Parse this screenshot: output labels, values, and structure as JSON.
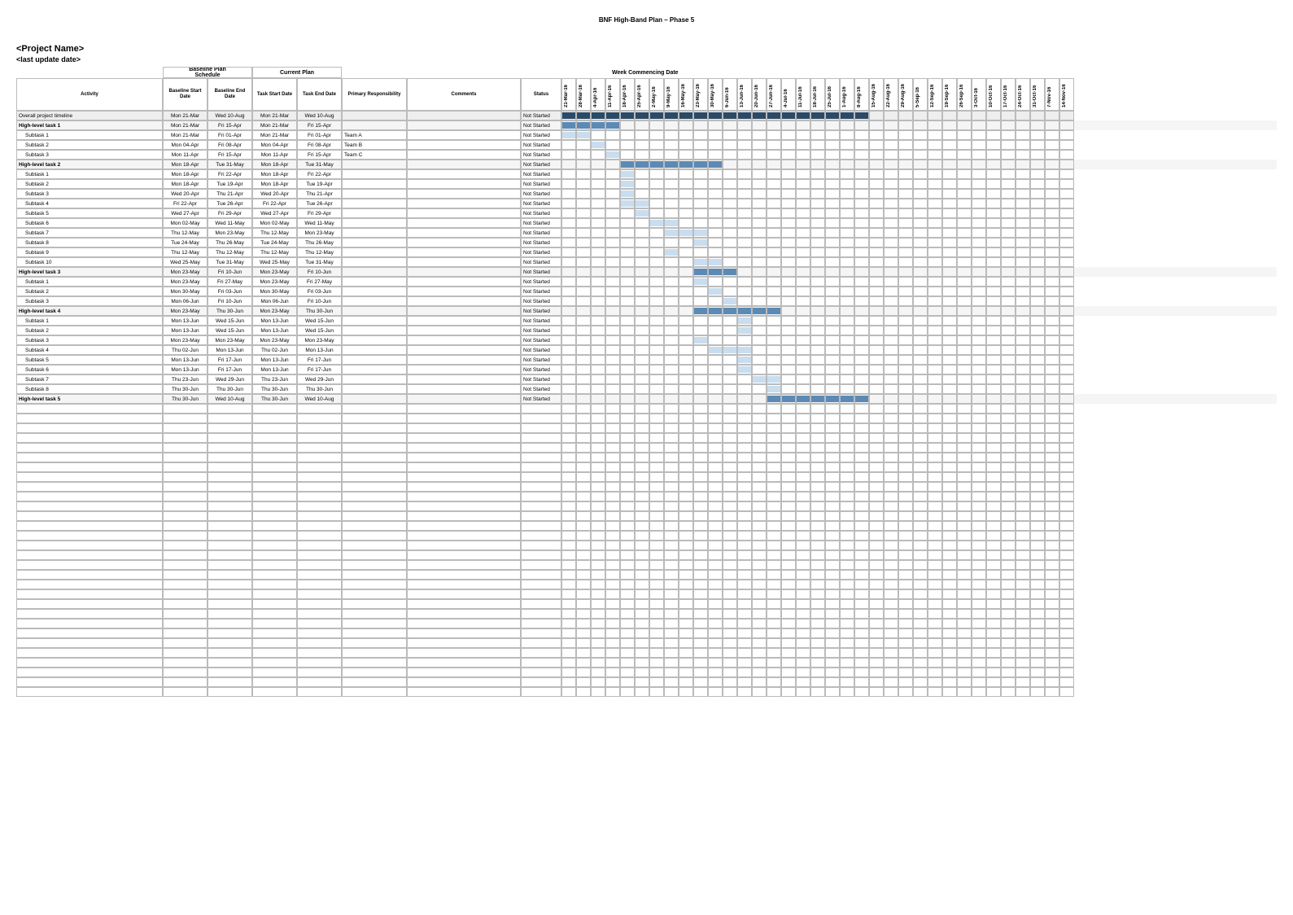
{
  "doc_title": "BNF High-Band Plan – Phase 5",
  "project_name": "<Project Name>",
  "last_update": "<last update date>",
  "headers": {
    "baseline_group": "Baseline Plan\nSchedule",
    "current_group": "Current Plan",
    "wc_group": "Week Commencing Date",
    "activity": "Activity",
    "baseline_start": "Baseline Start Date",
    "baseline_end": "Baseline End Date",
    "task_start": "Task Start Date",
    "task_end": "Task End Date",
    "primary_resp": "Primary Responsibility",
    "comments": "Comments",
    "status": "Status"
  },
  "weeks": [
    "21-Mar-16",
    "28-Mar-16",
    "4-Apr-16",
    "11-Apr-16",
    "18-Apr-16",
    "25-Apr-16",
    "2-May-16",
    "9-May-16",
    "16-May-16",
    "23-May-16",
    "30-May-16",
    "6-Jun-16",
    "13-Jun-16",
    "20-Jun-16",
    "27-Jun-16",
    "4-Jul-16",
    "11-Jul-16",
    "18-Jul-16",
    "25-Jul-16",
    "1-Aug-16",
    "8-Aug-16",
    "15-Aug-16",
    "22-Aug-16",
    "29-Aug-16",
    "5-Sep-16",
    "12-Sep-16",
    "19-Sep-16",
    "26-Sep-16",
    "3-Oct-16",
    "10-Oct-16",
    "17-Oct-16",
    "24-Oct-16",
    "31-Oct-16",
    "7-Nov-16",
    "14-Nov-16"
  ],
  "rows": [
    {
      "activity": "Overall project timeline",
      "bl_start": "Mon 21-Mar",
      "bl_end": "Wed 10-Aug",
      "cur_start": "Mon 21-Mar",
      "cur_end": "Wed 10-Aug",
      "resp": "",
      "comm": "",
      "status": "Not Started",
      "kind": "overall",
      "bar_start": 0,
      "bar_end": 20,
      "bar_class": "bar-dark"
    },
    {
      "activity": "High-level task 1",
      "bl_start": "Mon 21-Mar",
      "bl_end": "Fri 15-Apr",
      "cur_start": "Mon 21-Mar",
      "cur_end": "Fri 15-Apr",
      "resp": "",
      "comm": "",
      "status": "Not Started",
      "kind": "section",
      "bar_start": 0,
      "bar_end": 3,
      "bar_class": "bar-med"
    },
    {
      "activity": "Subtask 1",
      "bl_start": "Mon 21-Mar",
      "bl_end": "Fri 01-Apr",
      "cur_start": "Mon 21-Mar",
      "cur_end": "Fri 01-Apr",
      "resp": "Team A",
      "comm": "",
      "status": "Not Started",
      "kind": "sub",
      "bar_start": 0,
      "bar_end": 1,
      "bar_class": "bar-light"
    },
    {
      "activity": "Subtask 2",
      "bl_start": "Mon 04-Apr",
      "bl_end": "Fri 08-Apr",
      "cur_start": "Mon 04-Apr",
      "cur_end": "Fri 08-Apr",
      "resp": "Team B",
      "comm": "",
      "status": "Not Started",
      "kind": "sub",
      "bar_start": 2,
      "bar_end": 2,
      "bar_class": "bar-light"
    },
    {
      "activity": "Subtask 3",
      "bl_start": "Mon 11-Apr",
      "bl_end": "Fri 15-Apr",
      "cur_start": "Mon 11-Apr",
      "cur_end": "Fri 15-Apr",
      "resp": "Team C",
      "comm": "",
      "status": "Not Started",
      "kind": "sub",
      "bar_start": 3,
      "bar_end": 3,
      "bar_class": "bar-light"
    },
    {
      "activity": "High-level task 2",
      "bl_start": "Mon 18-Apr",
      "bl_end": "Tue 31-May",
      "cur_start": "Mon 18-Apr",
      "cur_end": "Tue 31-May",
      "resp": "",
      "comm": "",
      "status": "Not Started",
      "kind": "section",
      "bar_start": 4,
      "bar_end": 10,
      "bar_class": "bar-med"
    },
    {
      "activity": "Subtask 1",
      "bl_start": "Mon 18-Apr",
      "bl_end": "Fri 22-Apr",
      "cur_start": "Mon 18-Apr",
      "cur_end": "Fri 22-Apr",
      "resp": "",
      "comm": "",
      "status": "Not Started",
      "kind": "sub",
      "bar_start": 4,
      "bar_end": 4,
      "bar_class": "bar-light"
    },
    {
      "activity": "Subtask 2",
      "bl_start": "Mon 18-Apr",
      "bl_end": "Tue 19-Apr",
      "cur_start": "Mon 18-Apr",
      "cur_end": "Tue 19-Apr",
      "resp": "",
      "comm": "",
      "status": "Not Started",
      "kind": "sub",
      "bar_start": 4,
      "bar_end": 4,
      "bar_class": "bar-light"
    },
    {
      "activity": "Subtask 3",
      "bl_start": "Wed 20-Apr",
      "bl_end": "Thu 21-Apr",
      "cur_start": "Wed 20-Apr",
      "cur_end": "Thu 21-Apr",
      "resp": "",
      "comm": "",
      "status": "Not Started",
      "kind": "sub",
      "bar_start": 4,
      "bar_end": 4,
      "bar_class": "bar-light"
    },
    {
      "activity": "Subtask 4",
      "bl_start": "Fri 22-Apr",
      "bl_end": "Tue 26-Apr",
      "cur_start": "Fri 22-Apr",
      "cur_end": "Tue 26-Apr",
      "resp": "",
      "comm": "",
      "status": "Not Started",
      "kind": "sub",
      "bar_start": 4,
      "bar_end": 5,
      "bar_class": "bar-light"
    },
    {
      "activity": "Subtask 5",
      "bl_start": "Wed 27-Apr",
      "bl_end": "Fri 29-Apr",
      "cur_start": "Wed 27-Apr",
      "cur_end": "Fri 29-Apr",
      "resp": "",
      "comm": "",
      "status": "Not Started",
      "kind": "sub",
      "bar_start": 5,
      "bar_end": 5,
      "bar_class": "bar-light"
    },
    {
      "activity": "Subtask 6",
      "bl_start": "Mon 02-May",
      "bl_end": "Wed 11-May",
      "cur_start": "Mon 02-May",
      "cur_end": "Wed 11-May",
      "resp": "",
      "comm": "",
      "status": "Not Started",
      "kind": "sub",
      "bar_start": 6,
      "bar_end": 7,
      "bar_class": "bar-light"
    },
    {
      "activity": "Subtask 7",
      "bl_start": "Thu 12-May",
      "bl_end": "Mon 23-May",
      "cur_start": "Thu 12-May",
      "cur_end": "Mon 23-May",
      "resp": "",
      "comm": "",
      "status": "Not Started",
      "kind": "sub",
      "bar_start": 7,
      "bar_end": 9,
      "bar_class": "bar-light"
    },
    {
      "activity": "Subtask 8",
      "bl_start": "Tue 24-May",
      "bl_end": "Thu 26-May",
      "cur_start": "Tue 24-May",
      "cur_end": "Thu 26-May",
      "resp": "",
      "comm": "",
      "status": "Not Started",
      "kind": "sub",
      "bar_start": 9,
      "bar_end": 9,
      "bar_class": "bar-light"
    },
    {
      "activity": "Subtask 9",
      "bl_start": "Thu 12-May",
      "bl_end": "Thu 12-May",
      "cur_start": "Thu 12-May",
      "cur_end": "Thu 12-May",
      "resp": "",
      "comm": "",
      "status": "Not Started",
      "kind": "sub",
      "bar_start": 7,
      "bar_end": 7,
      "bar_class": "bar-light"
    },
    {
      "activity": "Subtask 10",
      "bl_start": "Wed 25-May",
      "bl_end": "Tue 31-May",
      "cur_start": "Wed 25-May",
      "cur_end": "Tue 31-May",
      "resp": "",
      "comm": "",
      "status": "Not Started",
      "kind": "sub",
      "bar_start": 9,
      "bar_end": 10,
      "bar_class": "bar-light"
    },
    {
      "activity": "High-level task 3",
      "bl_start": "Mon 23-May",
      "bl_end": "Fri 10-Jun",
      "cur_start": "Mon 23-May",
      "cur_end": "Fri 10-Jun",
      "resp": "",
      "comm": "",
      "status": "Not Started",
      "kind": "section",
      "bar_start": 9,
      "bar_end": 11,
      "bar_class": "bar-med"
    },
    {
      "activity": "Subtask 1",
      "bl_start": "Mon 23-May",
      "bl_end": "Fri 27-May",
      "cur_start": "Mon 23-May",
      "cur_end": "Fri 27-May",
      "resp": "",
      "comm": "",
      "status": "Not Started",
      "kind": "sub",
      "bar_start": 9,
      "bar_end": 9,
      "bar_class": "bar-light"
    },
    {
      "activity": "Subtask 2",
      "bl_start": "Mon 30-May",
      "bl_end": "Fri 03-Jun",
      "cur_start": "Mon 30-May",
      "cur_end": "Fri 03-Jun",
      "resp": "",
      "comm": "",
      "status": "Not Started",
      "kind": "sub",
      "bar_start": 10,
      "bar_end": 10,
      "bar_class": "bar-light"
    },
    {
      "activity": "Subtask 3",
      "bl_start": "Mon 06-Jun",
      "bl_end": "Fri 10-Jun",
      "cur_start": "Mon 06-Jun",
      "cur_end": "Fri 10-Jun",
      "resp": "",
      "comm": "",
      "status": "Not Started",
      "kind": "sub",
      "bar_start": 11,
      "bar_end": 11,
      "bar_class": "bar-light"
    },
    {
      "activity": "High-level task 4",
      "bl_start": "Mon 23-May",
      "bl_end": "Thu 30-Jun",
      "cur_start": "Mon 23-May",
      "cur_end": "Thu 30-Jun",
      "resp": "",
      "comm": "",
      "status": "Not Started",
      "kind": "section",
      "bar_start": 9,
      "bar_end": 14,
      "bar_class": "bar-med"
    },
    {
      "activity": "Subtask 1",
      "bl_start": "Mon 13-Jun",
      "bl_end": "Wed 15-Jun",
      "cur_start": "Mon 13-Jun",
      "cur_end": "Wed 15-Jun",
      "resp": "",
      "comm": "",
      "status": "Not Started",
      "kind": "sub",
      "bar_start": 12,
      "bar_end": 12,
      "bar_class": "bar-light"
    },
    {
      "activity": "Subtask 2",
      "bl_start": "Mon 13-Jun",
      "bl_end": "Wed 15-Jun",
      "cur_start": "Mon 13-Jun",
      "cur_end": "Wed 15-Jun",
      "resp": "",
      "comm": "",
      "status": "Not Started",
      "kind": "sub",
      "bar_start": 12,
      "bar_end": 12,
      "bar_class": "bar-light"
    },
    {
      "activity": "Subtask 3",
      "bl_start": "Mon 23-May",
      "bl_end": "Mon 23-May",
      "cur_start": "Mon 23-May",
      "cur_end": "Mon 23-May",
      "resp": "",
      "comm": "",
      "status": "Not Started",
      "kind": "sub",
      "bar_start": 9,
      "bar_end": 9,
      "bar_class": "bar-light"
    },
    {
      "activity": "Subtask 4",
      "bl_start": "Thu 02-Jun",
      "bl_end": "Mon 13-Jun",
      "cur_start": "Thu 02-Jun",
      "cur_end": "Mon 13-Jun",
      "resp": "",
      "comm": "",
      "status": "Not Started",
      "kind": "sub",
      "bar_start": 10,
      "bar_end": 12,
      "bar_class": "bar-light"
    },
    {
      "activity": "Subtask 5",
      "bl_start": "Mon 13-Jun",
      "bl_end": "Fri 17-Jun",
      "cur_start": "Mon 13-Jun",
      "cur_end": "Fri 17-Jun",
      "resp": "",
      "comm": "",
      "status": "Not Started",
      "kind": "sub",
      "bar_start": 12,
      "bar_end": 12,
      "bar_class": "bar-light"
    },
    {
      "activity": "Subtask 6",
      "bl_start": "Mon 13-Jun",
      "bl_end": "Fri 17-Jun",
      "cur_start": "Mon 13-Jun",
      "cur_end": "Fri 17-Jun",
      "resp": "",
      "comm": "",
      "status": "Not Started",
      "kind": "sub",
      "bar_start": 12,
      "bar_end": 12,
      "bar_class": "bar-light"
    },
    {
      "activity": "Subtask 7",
      "bl_start": "Thu 23-Jun",
      "bl_end": "Wed 29-Jun",
      "cur_start": "Thu 23-Jun",
      "cur_end": "Wed 29-Jun",
      "resp": "",
      "comm": "",
      "status": "Not Started",
      "kind": "sub",
      "bar_start": 13,
      "bar_end": 14,
      "bar_class": "bar-light"
    },
    {
      "activity": "Subtask 8",
      "bl_start": "Thu 30-Jun",
      "bl_end": "Thu 30-Jun",
      "cur_start": "Thu 30-Jun",
      "cur_end": "Thu 30-Jun",
      "resp": "",
      "comm": "",
      "status": "Not Started",
      "kind": "sub",
      "bar_start": 14,
      "bar_end": 14,
      "bar_class": "bar-light"
    },
    {
      "activity": "High-level task 5",
      "bl_start": "Thu 30-Jun",
      "bl_end": "Wed 10-Aug",
      "cur_start": "Thu 30-Jun",
      "cur_end": "Wed 10-Aug",
      "resp": "",
      "comm": "",
      "status": "Not Started",
      "kind": "section",
      "bar_start": 14,
      "bar_end": 20,
      "bar_class": "bar-med"
    }
  ],
  "empty_rows": 30
}
